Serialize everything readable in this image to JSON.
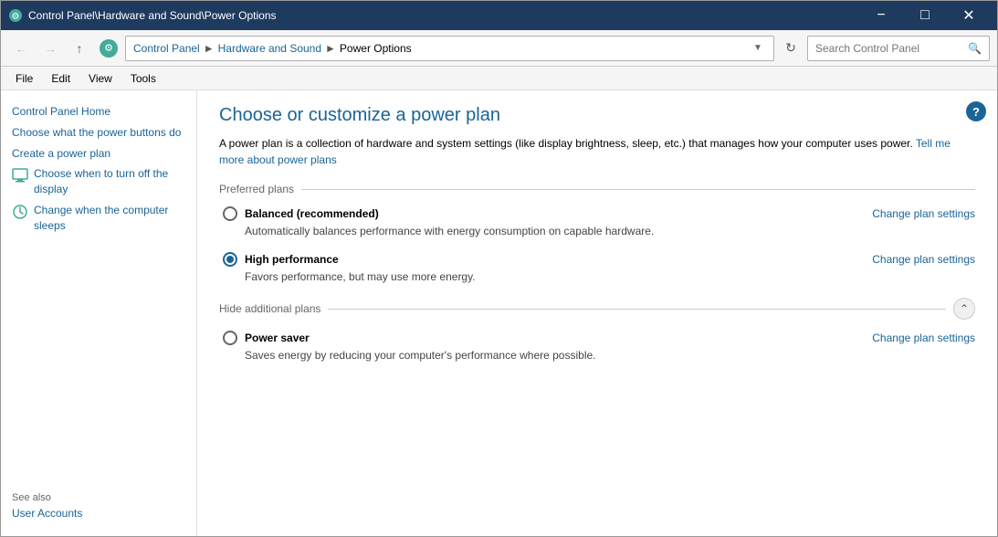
{
  "window": {
    "title": "Control Panel\\Hardware and Sound\\Power Options",
    "icon": "⚙"
  },
  "titlebar": {
    "minimize_label": "−",
    "maximize_label": "□",
    "close_label": "✕"
  },
  "addressbar": {
    "back_tooltip": "Back",
    "forward_tooltip": "Forward",
    "up_tooltip": "Up",
    "breadcrumb": {
      "home": "Control Panel",
      "section": "Hardware and Sound",
      "current": "Power Options"
    },
    "search_placeholder": "Search Control Panel",
    "refresh_tooltip": "Refresh"
  },
  "menubar": {
    "items": [
      "File",
      "Edit",
      "View",
      "Tools"
    ]
  },
  "sidebar": {
    "links": [
      {
        "label": "Control Panel Home",
        "icon": false
      },
      {
        "label": "Choose what the power buttons do",
        "icon": false
      },
      {
        "label": "Create a power plan",
        "icon": false
      },
      {
        "label": "Choose when to turn off the display",
        "icon": true
      },
      {
        "label": "Change when the computer sleeps",
        "icon": true
      }
    ],
    "see_also_title": "See also",
    "see_also_links": [
      "User Accounts"
    ]
  },
  "content": {
    "title": "Choose or customize a power plan",
    "description_part1": "A power plan is a collection of hardware and system settings (like display brightness, sleep, etc.) that manages how your computer uses power.",
    "description_link": "Tell me more about power plans",
    "preferred_plans_label": "Preferred plans",
    "hide_plans_label": "Hide additional plans",
    "plans": [
      {
        "id": "balanced",
        "name": "Balanced (recommended)",
        "description": "Automatically balances performance with energy consumption on capable hardware.",
        "selected": false,
        "change_link": "Change plan settings"
      },
      {
        "id": "high",
        "name": "High performance",
        "description": "Favors performance, but may use more energy.",
        "selected": true,
        "change_link": "Change plan settings"
      },
      {
        "id": "saver",
        "name": "Power saver",
        "description": "Saves energy by reducing your computer's performance where possible.",
        "selected": false,
        "change_link": "Change plan settings"
      }
    ],
    "help_tooltip": "?"
  }
}
